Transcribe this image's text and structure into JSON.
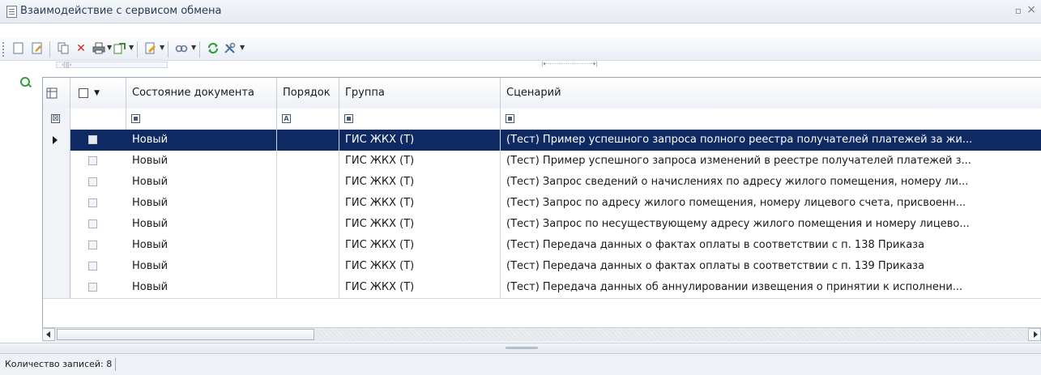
{
  "window": {
    "title": "Взаимодействие с сервисом обмена"
  },
  "toolbar": {
    "icons": [
      "new-document-icon",
      "edit-icon",
      "copy-icon",
      "delete-icon",
      "print-icon",
      "export-icon",
      "document-action-icon",
      "link-icon",
      "refresh-icon",
      "tools-icon"
    ]
  },
  "grid": {
    "columns": [
      "Состояние документа",
      "Порядок",
      "Группа",
      "Сценарий"
    ],
    "rows": [
      {
        "state": "Новый",
        "order": "",
        "group": "ГИС ЖКХ (Т)",
        "scenario": "(Тест) Пример успешного запроса полного реестра получателей платежей за жи..."
      },
      {
        "state": "Новый",
        "order": "",
        "group": "ГИС ЖКХ (Т)",
        "scenario": "(Тест) Пример успешного запроса изменений в реестре получателей платежей з..."
      },
      {
        "state": "Новый",
        "order": "",
        "group": "ГИС ЖКХ (Т)",
        "scenario": "(Тест) Запрос сведений о начислениях по адресу жилого помещения, номеру ли..."
      },
      {
        "state": "Новый",
        "order": "",
        "group": "ГИС ЖКХ (Т)",
        "scenario": "(Тест) Запрос по адресу жилого помещения, номеру лицевого счета, присвоенн..."
      },
      {
        "state": "Новый",
        "order": "",
        "group": "ГИС ЖКХ (Т)",
        "scenario": "(Тест) Запрос по несуществующему адресу жилого помещения и номеру лицево..."
      },
      {
        "state": "Новый",
        "order": "",
        "group": "ГИС ЖКХ (Т)",
        "scenario": "(Тест) Передача данных о фактах оплаты в соответствии с п. 138 Приказа"
      },
      {
        "state": "Новый",
        "order": "",
        "group": "ГИС ЖКХ (Т)",
        "scenario": "(Тест) Передача данных о фактах оплаты в соответствии с п. 139 Приказа"
      },
      {
        "state": "Новый",
        "order": "",
        "group": "ГИС ЖКХ (Т)",
        "scenario": "(Тест) Передача данных об аннулировании извещения о принятии к исполнени..."
      }
    ],
    "selected_row": 0
  },
  "status": {
    "records": "Количество записей: 8"
  },
  "colors": {
    "selection": "#0f2a63",
    "accent": "#2f9e3c"
  }
}
